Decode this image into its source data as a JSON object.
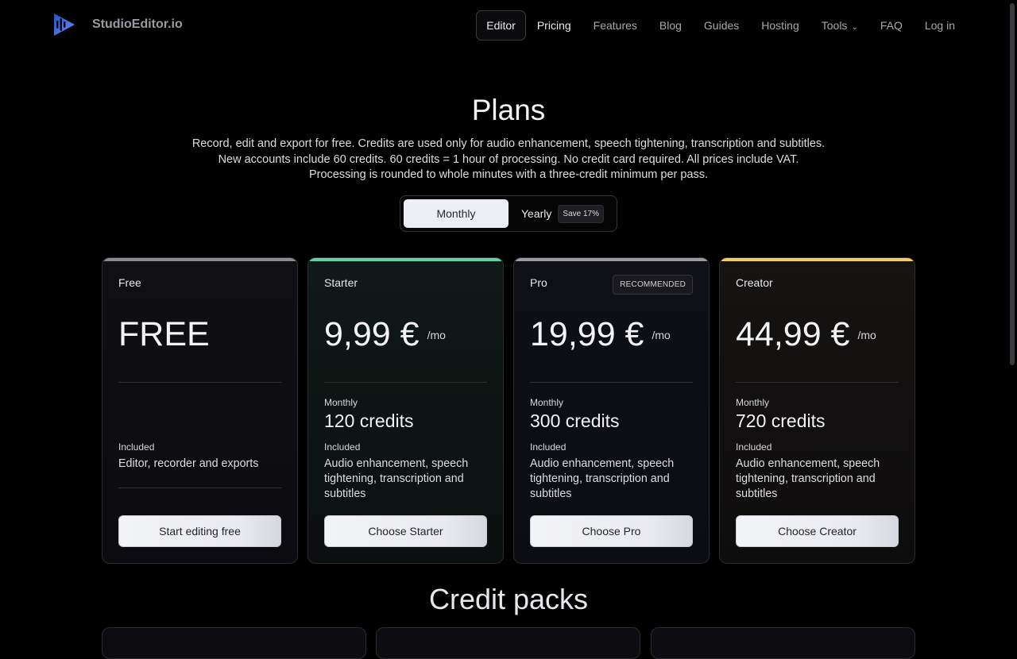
{
  "app": {
    "brand": "StudioEditor.io"
  },
  "nav": {
    "items": [
      {
        "label": "Editor"
      },
      {
        "label": "Pricing"
      },
      {
        "label": "Features"
      },
      {
        "label": "Blog"
      },
      {
        "label": "Guides"
      },
      {
        "label": "Hosting"
      },
      {
        "label": "Tools"
      },
      {
        "label": "FAQ"
      },
      {
        "label": "Log in"
      }
    ],
    "tools_caret_icon": "chevron-down-icon"
  },
  "hero": {
    "title": "Plans",
    "lines": [
      "Record, edit and export for free. Credits are used only for audio enhancement, speech tightening, transcription and subtitles.",
      "New accounts include 60 credits. 60 credits = 1 hour of processing. No credit card required. All prices include VAT.",
      "Processing is rounded to whole minutes with a three-credit minimum per pass."
    ]
  },
  "billing_toggle": {
    "monthly": "Monthly",
    "yearly": "Yearly",
    "save_badge": "Save 17%",
    "selected": "Monthly"
  },
  "plans": [
    {
      "name": "Free",
      "price": "FREE",
      "per": "",
      "period_label": "",
      "credits": "",
      "included_label": "Included",
      "included": "Editor, recorder and exports",
      "cta": "Start editing free",
      "accent": "#8a8a90"
    },
    {
      "name": "Starter",
      "price": "9,99 €",
      "per": "/mo",
      "period_label": "Monthly",
      "credits": "120 credits",
      "included_label": "Included",
      "included": "Audio enhancement, speech tightening, transcription and subtitles",
      "cta": "Choose Starter",
      "accent": "#5fd3a3"
    },
    {
      "name": "Pro",
      "badge": "RECOMMENDED",
      "price": "19,99 €",
      "per": "/mo",
      "period_label": "Monthly",
      "credits": "300 credits",
      "included_label": "Included",
      "included": "Audio enhancement, speech tightening, transcription and subtitles",
      "cta": "Choose Pro",
      "accent": "#9a9aa0"
    },
    {
      "name": "Creator",
      "price": "44,99 €",
      "per": "/mo",
      "period_label": "Monthly",
      "credits": "720 credits",
      "included_label": "Included",
      "included": "Audio enhancement, speech tightening, transcription and subtitles",
      "cta": "Choose Creator",
      "accent": "#f2cd5c"
    }
  ],
  "credit_packs": {
    "title": "Credit packs"
  }
}
